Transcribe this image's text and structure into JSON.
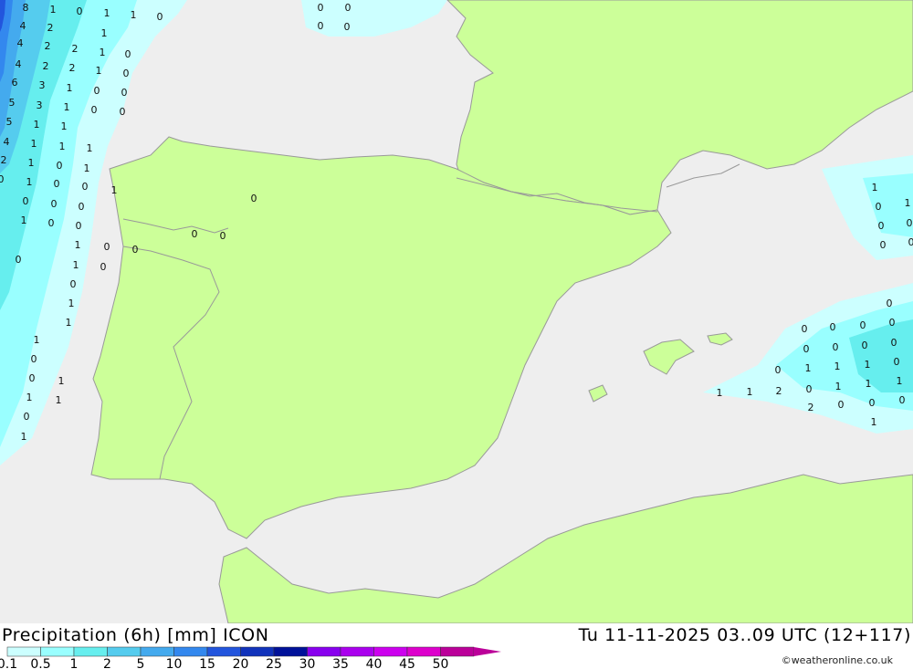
{
  "title": "Precipitation (6h) [mm] ICON",
  "valid_time": "Tu 11-11-2025 03..09 UTC (12+117)",
  "credit": "©weatheronline.co.uk",
  "colors": {
    "sea": "#eeeeee",
    "land": "#ccff99",
    "border": "#999999"
  },
  "legend": [
    {
      "label": "0.1",
      "color": "#ccffff"
    },
    {
      "label": "0.5",
      "color": "#99ffff"
    },
    {
      "label": "1",
      "color": "#66eeee"
    },
    {
      "label": "2",
      "color": "#55ccee"
    },
    {
      "label": "5",
      "color": "#44aaee"
    },
    {
      "label": "10",
      "color": "#3388ee"
    },
    {
      "label": "15",
      "color": "#2255dd"
    },
    {
      "label": "20",
      "color": "#1133bb"
    },
    {
      "label": "25",
      "color": "#001199"
    },
    {
      "label": "30",
      "color": "#8800ee"
    },
    {
      "label": "35",
      "color": "#aa00ee"
    },
    {
      "label": "40",
      "color": "#cc00ee"
    },
    {
      "label": "45",
      "color": "#dd00cc"
    },
    {
      "label": "50",
      "color": "#bb0099"
    }
  ],
  "map_values": [
    "8",
    "1",
    "0",
    "1",
    "1",
    "0",
    "0",
    "0",
    "0",
    "0",
    "4",
    "2",
    "1",
    "4",
    "2",
    "2",
    "1",
    "0",
    "4",
    "2",
    "2",
    "1",
    "0",
    "6",
    "3",
    "1",
    "0",
    "0",
    "5",
    "3",
    "1",
    "0",
    "0",
    "5",
    "1",
    "1",
    "4",
    "1",
    "1",
    "1",
    "2",
    "1",
    "0",
    "1",
    "1",
    "0",
    "1",
    "0",
    "0",
    "0",
    "0",
    "0",
    "1",
    "0",
    "0",
    "1",
    "0",
    "0",
    "0",
    "0",
    "0",
    "0",
    "1",
    "0",
    "0",
    "1",
    "1",
    "1",
    "0",
    "0",
    "1",
    "1",
    "1",
    "0",
    "1",
    "1",
    "0",
    "1",
    "0",
    "0",
    "0",
    "0",
    "0",
    "0",
    "0",
    "0",
    "0",
    "0",
    "0",
    "0",
    "0",
    "0",
    "1",
    "1",
    "1",
    "0",
    "1",
    "1",
    "2",
    "0",
    "1",
    "1",
    "1",
    "2",
    "0",
    "0",
    "0",
    "1",
    "1",
    "1",
    "1",
    "0",
    "0",
    "1",
    "1",
    "0"
  ]
}
